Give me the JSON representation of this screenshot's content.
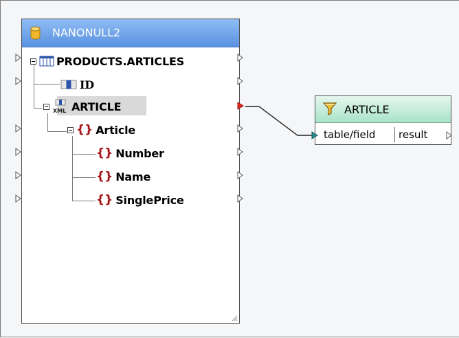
{
  "source_component": {
    "title": "NANONULL2",
    "title_icon": "database-icon",
    "items": [
      {
        "label": "PRODUCTS.ARTICLES",
        "icon": "table-icon",
        "expander": true
      },
      {
        "label": "ID",
        "icon": "column-icon",
        "expander": false
      },
      {
        "label": "ARTICLE",
        "icon": "xml-column-icon",
        "expander": true,
        "selected": true
      },
      {
        "label": "Article",
        "icon": "xml-element-icon",
        "expander": true
      },
      {
        "label": "Number",
        "icon": "xml-element-icon",
        "expander": false
      },
      {
        "label": "Name",
        "icon": "xml-element-icon",
        "expander": false
      },
      {
        "label": "SinglePrice",
        "icon": "xml-element-icon",
        "expander": false
      }
    ]
  },
  "target_component": {
    "title": "ARTICLE",
    "title_icon": "filter-icon",
    "input_param": "table/field",
    "output_param": "result"
  },
  "connection": {
    "from": "ARTICLE",
    "to": "table/field",
    "active_port_color": "#e0261c",
    "target_port_color": "#2a8c8c"
  },
  "colors": {
    "source_title_bg": "#6fa3ea",
    "target_title_bg": "#b9e8d3",
    "selection": "#d9d9d9"
  }
}
